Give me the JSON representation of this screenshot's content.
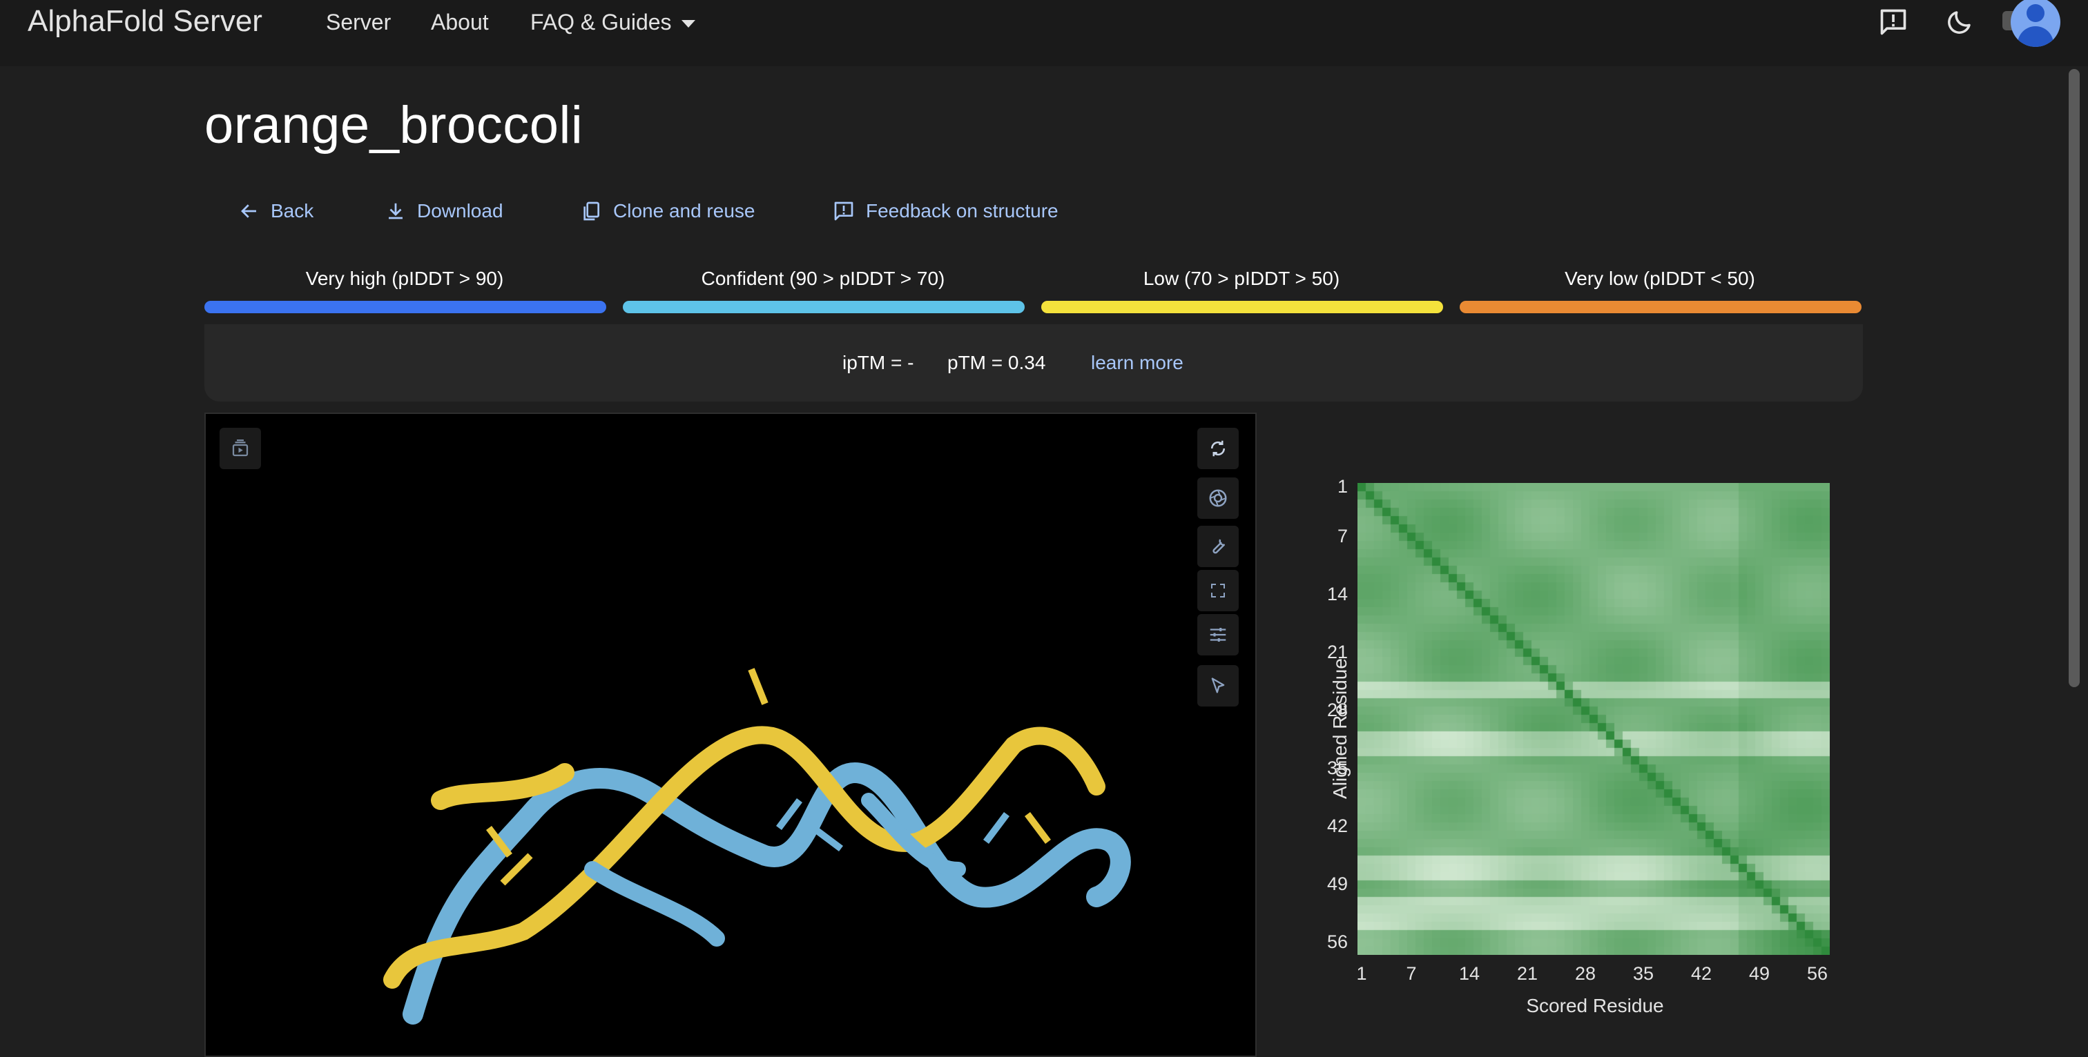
{
  "app": {
    "brand": "AlphaFold Server"
  },
  "nav": {
    "server": "Server",
    "about": "About",
    "faq": "FAQ & Guides"
  },
  "page": {
    "title": "orange_broccoli"
  },
  "actions": {
    "back": "Back",
    "download": "Download",
    "clone": "Clone and reuse",
    "feedback": "Feedback on structure"
  },
  "plddt": [
    {
      "label": "Very high (pIDDT > 90)",
      "color": "#3b73f0"
    },
    {
      "label": "Confident (90 > pIDDT > 70)",
      "color": "#5ec3e8"
    },
    {
      "label": "Low (70 > pIDDT > 50)",
      "color": "#f4e23c"
    },
    {
      "label": "Very low (pIDDT < 50)",
      "color": "#e98a33"
    }
  ],
  "metrics": {
    "iptm": "ipTM = -",
    "ptm": "pTM = 0.34",
    "learn_more": "learn more"
  },
  "viewer": {
    "icons": [
      "sequence-panel-icon",
      "reset-view-icon",
      "screenshot-icon",
      "settings-icon",
      "fullscreen-icon",
      "controls-icon",
      "selection-mode-icon"
    ],
    "chain_colors": {
      "chain_a": "#6fb1d8",
      "chain_b": "#e8c63c"
    }
  },
  "pae_plot": {
    "xlabel": "Scored Residue",
    "ylabel": "Aligned Residue",
    "x_ticks": [
      "1",
      "7",
      "14",
      "21",
      "28",
      "35",
      "42",
      "49",
      "56"
    ],
    "y_ticks": [
      "1",
      "7",
      "14",
      "21",
      "28",
      "35",
      "42",
      "49",
      "56"
    ],
    "n_residues": 57,
    "colors": {
      "low_error": "#2f8a3c",
      "high_error": "#e6f4e4"
    }
  }
}
